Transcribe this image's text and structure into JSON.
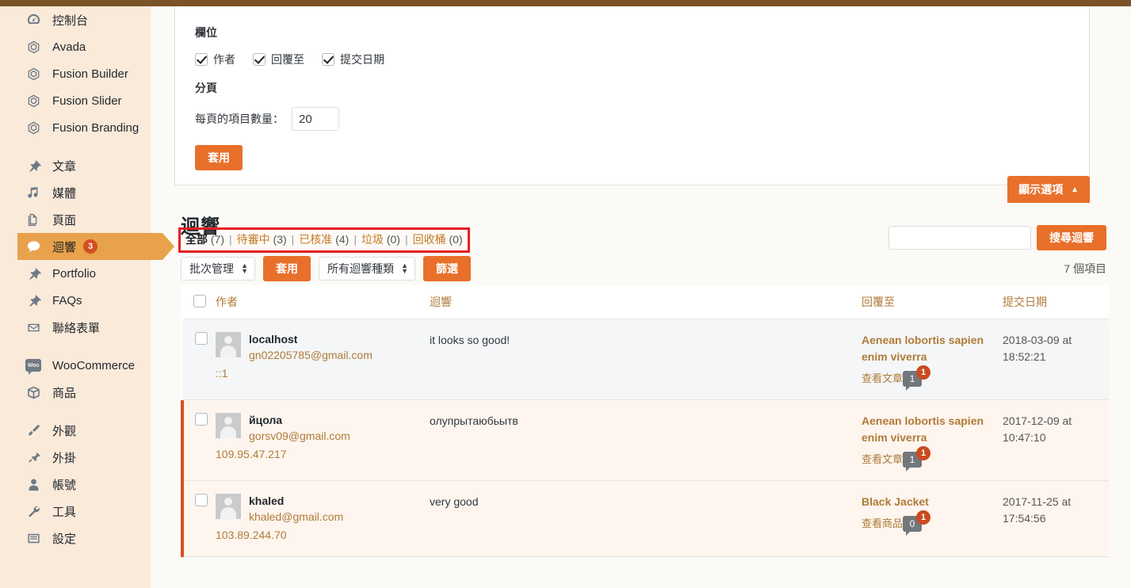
{
  "sidebar": {
    "groups": [
      {
        "items": [
          {
            "label": "控制台",
            "icon": "dashboard-icon",
            "name": "sidebar-item-dashboard"
          },
          {
            "label": "Avada",
            "icon": "avada-icon",
            "name": "sidebar-item-avada"
          },
          {
            "label": "Fusion Builder",
            "icon": "avada-icon",
            "name": "sidebar-item-fusion-builder"
          },
          {
            "label": "Fusion Slider",
            "icon": "avada-icon",
            "name": "sidebar-item-fusion-slider"
          },
          {
            "label": "Fusion Branding",
            "icon": "avada-icon",
            "name": "sidebar-item-fusion-branding"
          }
        ]
      },
      {
        "items": [
          {
            "label": "文章",
            "icon": "pin-icon",
            "name": "sidebar-item-posts"
          },
          {
            "label": "媒體",
            "icon": "media-icon",
            "name": "sidebar-item-media"
          },
          {
            "label": "頁面",
            "icon": "pages-icon",
            "name": "sidebar-item-pages"
          },
          {
            "label": "迴響",
            "icon": "comment-icon",
            "name": "sidebar-item-comments",
            "badge": "3",
            "active": true
          },
          {
            "label": "Portfolio",
            "icon": "pin-icon",
            "name": "sidebar-item-portfolio"
          },
          {
            "label": "FAQs",
            "icon": "pin-icon",
            "name": "sidebar-item-faqs"
          },
          {
            "label": "聯絡表單",
            "icon": "mail-icon",
            "name": "sidebar-item-contact-form"
          }
        ]
      },
      {
        "items": [
          {
            "label": "WooCommerce",
            "icon": "woo-icon",
            "name": "sidebar-item-woocommerce"
          },
          {
            "label": "商品",
            "icon": "box-icon",
            "name": "sidebar-item-products"
          }
        ]
      },
      {
        "items": [
          {
            "label": "外觀",
            "icon": "brush-icon",
            "name": "sidebar-item-appearance"
          },
          {
            "label": "外掛",
            "icon": "plug-icon",
            "name": "sidebar-item-plugins"
          },
          {
            "label": "帳號",
            "icon": "user-icon",
            "name": "sidebar-item-users"
          },
          {
            "label": "工具",
            "icon": "wrench-icon",
            "name": "sidebar-item-tools"
          },
          {
            "label": "設定",
            "icon": "settings-icon",
            "name": "sidebar-item-settings"
          }
        ]
      }
    ]
  },
  "screen_options": {
    "columns_label": "欄位",
    "columns": [
      {
        "label": "作者",
        "checked": true
      },
      {
        "label": "回覆至",
        "checked": true
      },
      {
        "label": "提交日期",
        "checked": true
      }
    ],
    "pagination_label": "分頁",
    "per_page_label": "每頁的項目數量：",
    "per_page_value": "20",
    "apply_label": "套用",
    "tab_label": "顯示選項",
    "tab_caret": "▲"
  },
  "page": {
    "title": "迴響",
    "item_count": "7 個項目"
  },
  "filters": {
    "links": [
      {
        "label": "全部",
        "count": "(7)",
        "current": true
      },
      {
        "label": "待審中",
        "count": "(3)",
        "current": false
      },
      {
        "label": "已核准",
        "count": "(4)",
        "current": false
      },
      {
        "label": "垃圾",
        "count": "(0)",
        "current": false
      },
      {
        "label": "回收桶",
        "count": "(0)",
        "current": false
      }
    ],
    "separator": "|",
    "highlight_color": "#e41f1f"
  },
  "search": {
    "value": "",
    "placeholder": "",
    "button_label": "搜尋迴響"
  },
  "tablenav": {
    "bulk_action_label": "批次管理",
    "bulk_apply_label": "套用",
    "comment_type_label": "所有迴響種類",
    "filter_label": "篩選"
  },
  "table": {
    "headers": {
      "author": "作者",
      "comment": "迴響",
      "response": "回覆至",
      "date": "提交日期"
    },
    "rows": [
      {
        "status": "approved",
        "author_name": "localhost",
        "author_email": "gn02205785@gmail.com",
        "author_ip": "::1",
        "comment": "it looks so good!",
        "response_title": "Aenean lobortis sapien enim viverra",
        "response_link": "查看文章",
        "bubble_count": "1",
        "bubble_badge": "1",
        "date": "2018-03-09 at 18:52:21"
      },
      {
        "status": "pending",
        "author_name": "йцола",
        "author_email": "gorsv09@gmail.com",
        "author_ip": "109.95.47.217",
        "comment": "олупрытаюбьытв",
        "response_title": "Aenean lobortis sapien enim viverra",
        "response_link": "查看文章",
        "bubble_count": "1",
        "bubble_badge": "1",
        "date": "2017-12-09 at 10:47:10"
      },
      {
        "status": "pending",
        "author_name": "khaled",
        "author_email": "khaled@gmail.com",
        "author_ip": "103.89.244.70",
        "comment": "very good",
        "response_title": "Black Jacket",
        "response_link": "查看商品",
        "bubble_count": "0",
        "bubble_badge": "1",
        "date": "2017-11-25 at 17:54:56"
      }
    ]
  },
  "colors": {
    "admin_bar": "#7b5328",
    "sidebar_bg": "#faeada",
    "accent_orange": "#e8702a",
    "active_menu": "#e8a24b",
    "badge_red": "#d54e21",
    "link_brown": "#b07b38"
  }
}
